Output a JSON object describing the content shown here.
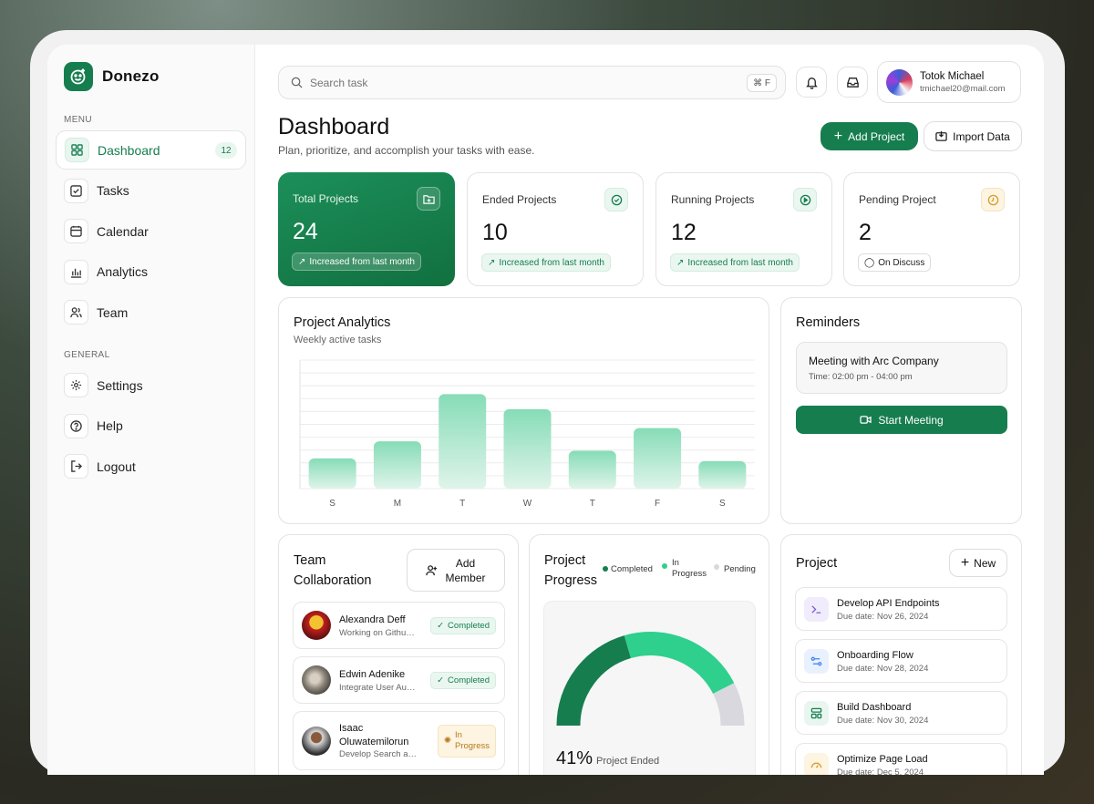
{
  "brand": {
    "name": "Donezo"
  },
  "sidebar": {
    "menu_label": "MENU",
    "general_label": "GENERAL",
    "menu": [
      {
        "label": "Dashboard",
        "badge": "12",
        "icon": "grid-icon"
      },
      {
        "label": "Tasks",
        "icon": "checkbox-icon"
      },
      {
        "label": "Calendar",
        "icon": "calendar-icon"
      },
      {
        "label": "Analytics",
        "icon": "bar-chart-icon"
      },
      {
        "label": "Team",
        "icon": "users-icon"
      }
    ],
    "general": [
      {
        "label": "Settings",
        "icon": "gear-icon"
      },
      {
        "label": "Help",
        "icon": "help-icon"
      },
      {
        "label": "Logout",
        "icon": "logout-icon"
      }
    ]
  },
  "topbar": {
    "search_placeholder": "Search task",
    "shortcut": "⌘ F",
    "user_name": "Totok Michael",
    "user_email": "tmichael20@mail.com"
  },
  "header": {
    "title": "Dashboard",
    "subtitle": "Plan, prioritize, and accomplish your tasks with ease.",
    "add_project": "Add Project",
    "import_data": "Import Data"
  },
  "stats": [
    {
      "label": "Total Projects",
      "value": "24",
      "tag": "Increased from last month"
    },
    {
      "label": "Ended Projects",
      "value": "10",
      "tag": "Increased from last month"
    },
    {
      "label": "Running Projects",
      "value": "12",
      "tag": "Increased from last month"
    },
    {
      "label": "Pending Project",
      "value": "2",
      "tag": "On Discuss"
    }
  ],
  "analytics": {
    "title": "Project Analytics",
    "subtitle": "Weekly active tasks"
  },
  "chart_data": {
    "type": "bar",
    "categories": [
      "S",
      "M",
      "T",
      "W",
      "T",
      "F",
      "S"
    ],
    "values": [
      32,
      50,
      100,
      84,
      40,
      64,
      29
    ],
    "title": "Project Analytics",
    "subtitle": "Weekly active tasks",
    "xlabel": "",
    "ylabel": "",
    "ylim": [
      0,
      136
    ],
    "grid": true,
    "bar_color": "#2fbf85"
  },
  "reminders": {
    "title": "Reminders",
    "meeting_title": "Meeting with Arc Company",
    "meeting_time": "Time: 02:00 pm - 04:00 pm",
    "start_label": "Start Meeting"
  },
  "team": {
    "title_line1": "Team",
    "title_line2": "Collaboration",
    "add_line1": "Add",
    "add_line2": "Member",
    "members": [
      {
        "name": "Alexandra Deff",
        "task": "Working on Github Project Repository",
        "status": "Completed"
      },
      {
        "name": "Edwin Adenike",
        "task": "Integrate User Authentication System",
        "status": "Completed"
      },
      {
        "name_line1": "Isaac",
        "name_line2": "Oluwatemilorun",
        "task": "Develop Search and Filter Functionality",
        "status_line1": "In",
        "status_line2": "Progress"
      }
    ]
  },
  "progress": {
    "title_line1": "Project",
    "title_line2": "Progress",
    "legend": [
      {
        "label": "Completed",
        "color": "#167d4f"
      },
      {
        "label_line1": "In",
        "label_line2": "Progress",
        "color": "#2fcf8e"
      },
      {
        "label": "Pending",
        "color": "#d8d8de"
      }
    ],
    "percent": "41%",
    "caption": "Project Ended",
    "completed_fraction": 0.41,
    "in_progress_fraction": 0.44,
    "pending_fraction": 0.15
  },
  "projects": {
    "title": "Project",
    "new_label": "New",
    "items": [
      {
        "name": "Develop API Endpoints",
        "due": "Due date: Nov 26, 2024",
        "icon": "terminal-icon",
        "color": "#7b5cd6"
      },
      {
        "name": "Onboarding Flow",
        "due": "Due date: Nov 28, 2024",
        "icon": "flow-icon",
        "color": "#3b82f6"
      },
      {
        "name": "Build Dashboard",
        "due": "Due date: Nov 30, 2024",
        "icon": "layout-icon",
        "color": "#167d4f"
      },
      {
        "name": "Optimize Page Load",
        "due": "Due date: Dec 5, 2024",
        "icon": "gauge-icon",
        "color": "#d69e2e"
      }
    ]
  }
}
